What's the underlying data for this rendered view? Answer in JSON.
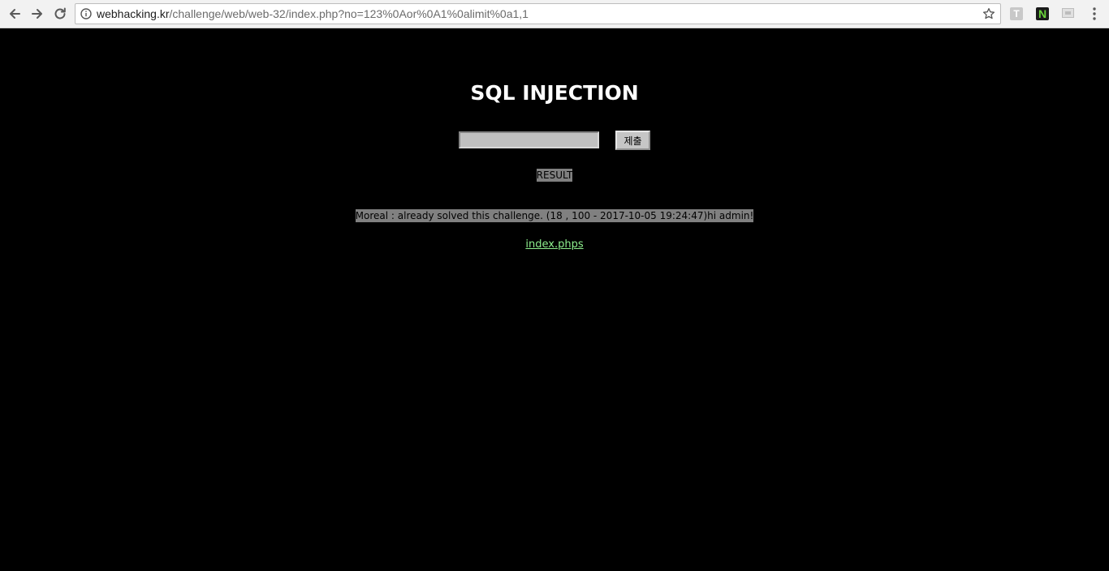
{
  "browser": {
    "url_host": "webhacking.kr",
    "url_path": "/challenge/web/web-32/index.php?no=123%0Aor%0A1%0alimit%0a1,1",
    "extensions": {
      "t_label": "T",
      "n_label": "N"
    }
  },
  "page": {
    "title": "SQL INJECTION",
    "search": {
      "value": "",
      "submit_label": "제출"
    },
    "result_label": "RESULT",
    "result_message": "Moreal : already solved this challenge. (18 , 100 - 2017-10-05 19:24:47)hi admin!",
    "source_link": "index.phps"
  },
  "colors": {
    "background": "#000000",
    "title": "#ffffff",
    "highlight": "#808080",
    "link": "#8df08d"
  }
}
